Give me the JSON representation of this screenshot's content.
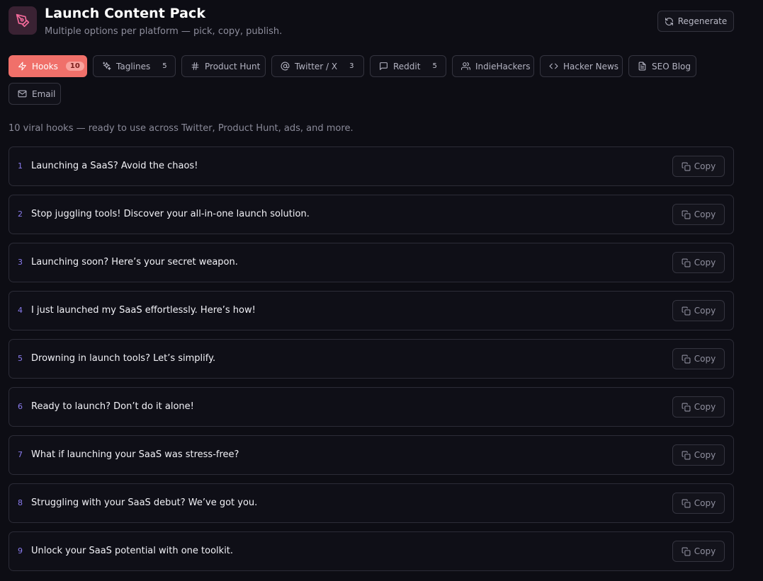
{
  "header": {
    "title": "Launch Content Pack",
    "subtitle": "Multiple options per platform — pick, copy, publish.",
    "regenerate_label": "Regenerate",
    "icon": "pen-tool-icon",
    "icon_bg": "#3a2233",
    "icon_color": "#f26a9a"
  },
  "tabs": [
    {
      "label": "Hooks",
      "count": "10",
      "icon": "zap-icon",
      "active": true
    },
    {
      "label": "Taglines",
      "count": "5",
      "icon": "sparkles-icon",
      "active": false
    },
    {
      "label": "Product Hunt",
      "count": "",
      "icon": "hash-icon",
      "active": false
    },
    {
      "label": "Twitter / X",
      "count": "3",
      "icon": "at-sign-icon",
      "active": false
    },
    {
      "label": "Reddit",
      "count": "5",
      "icon": "message-square-icon",
      "active": false
    },
    {
      "label": "IndieHackers",
      "count": "",
      "icon": "users-icon",
      "active": false
    },
    {
      "label": "Hacker News",
      "count": "",
      "icon": "code-icon",
      "active": false
    },
    {
      "label": "SEO Blog",
      "count": "",
      "icon": "file-text-icon",
      "active": false
    },
    {
      "label": "Email",
      "count": "",
      "icon": "mail-icon",
      "active": false
    }
  ],
  "description": "10 viral hooks — ready to use across Twitter, Product Hunt, ads, and more.",
  "copy_label": "Copy",
  "hooks": [
    {
      "num": "1",
      "text": "Launching a SaaS? Avoid the chaos!"
    },
    {
      "num": "2",
      "text": "Stop juggling tools! Discover your all-in-one launch solution."
    },
    {
      "num": "3",
      "text": "Launching soon? Here’s your secret weapon."
    },
    {
      "num": "4",
      "text": "I just launched my SaaS effortlessly. Here’s how!"
    },
    {
      "num": "5",
      "text": "Drowning in launch tools? Let’s simplify."
    },
    {
      "num": "6",
      "text": "Ready to launch? Don’t do it alone!"
    },
    {
      "num": "7",
      "text": "What if launching your SaaS was stress-free?"
    },
    {
      "num": "8",
      "text": "Struggling with your SaaS debut? We’ve got you."
    },
    {
      "num": "9",
      "text": "Unlock your SaaS potential with one toolkit."
    }
  ],
  "colors": {
    "background": "#0d0d14",
    "accent": "#f0706a",
    "number": "#8b7cf0",
    "border": "#2c2c37"
  }
}
